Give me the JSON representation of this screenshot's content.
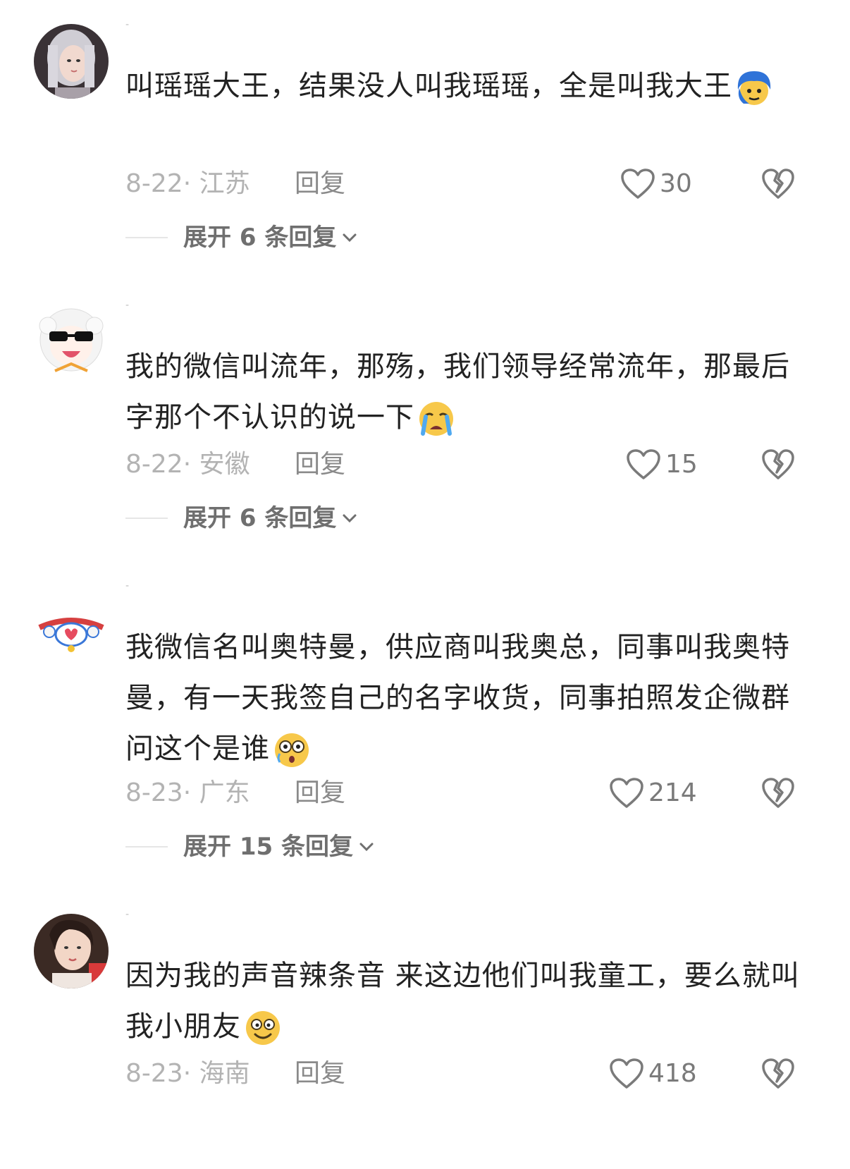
{
  "comments": [
    {
      "avatar_icon": "avatar-girl-silver-hair",
      "text": "叫瑶瑶大王，结果没人叫我瑶瑶，全是叫我大王",
      "emoji_icon": "blue-hair-emoji-icon",
      "date_location": "8-22· 江苏",
      "reply_label": "回复",
      "likes": "30",
      "expand_label": "展开 6 条回复"
    },
    {
      "avatar_icon": "avatar-sheep-sunglasses",
      "text": "我的微信叫流年，那殇，我们领导经常流年，那最后字那个不认识的说一下",
      "emoji_icon": "crying-face-icon",
      "date_location": "8-22· 安徽",
      "reply_label": "回复",
      "likes": "15",
      "expand_label": "展开 6 条回复"
    },
    {
      "avatar_icon": "avatar-cartoon-heart",
      "text": "我微信名叫奥特曼，供应商叫我奥总，同事叫我奥特曼，有一天我签自己的名字收货，同事拍照发企微群问这个是谁",
      "emoji_icon": "shocked-face-icon",
      "date_location": "8-23· 广东",
      "reply_label": "回复",
      "likes": "214",
      "expand_label": "展开 15 条回复"
    },
    {
      "avatar_icon": "avatar-girl-selfie",
      "text": "因为我的声音辣条音  来这边他们叫我童工，要么就叫我小朋友",
      "emoji_icon": "dizzy-smile-face-icon",
      "date_location": "8-23· 海南",
      "reply_label": "回复",
      "likes": "418"
    }
  ],
  "colors": {
    "text": "#222222",
    "meta": "#b3b3b3",
    "reply": "#8a8a8a",
    "icon": "#7a7a7a"
  }
}
